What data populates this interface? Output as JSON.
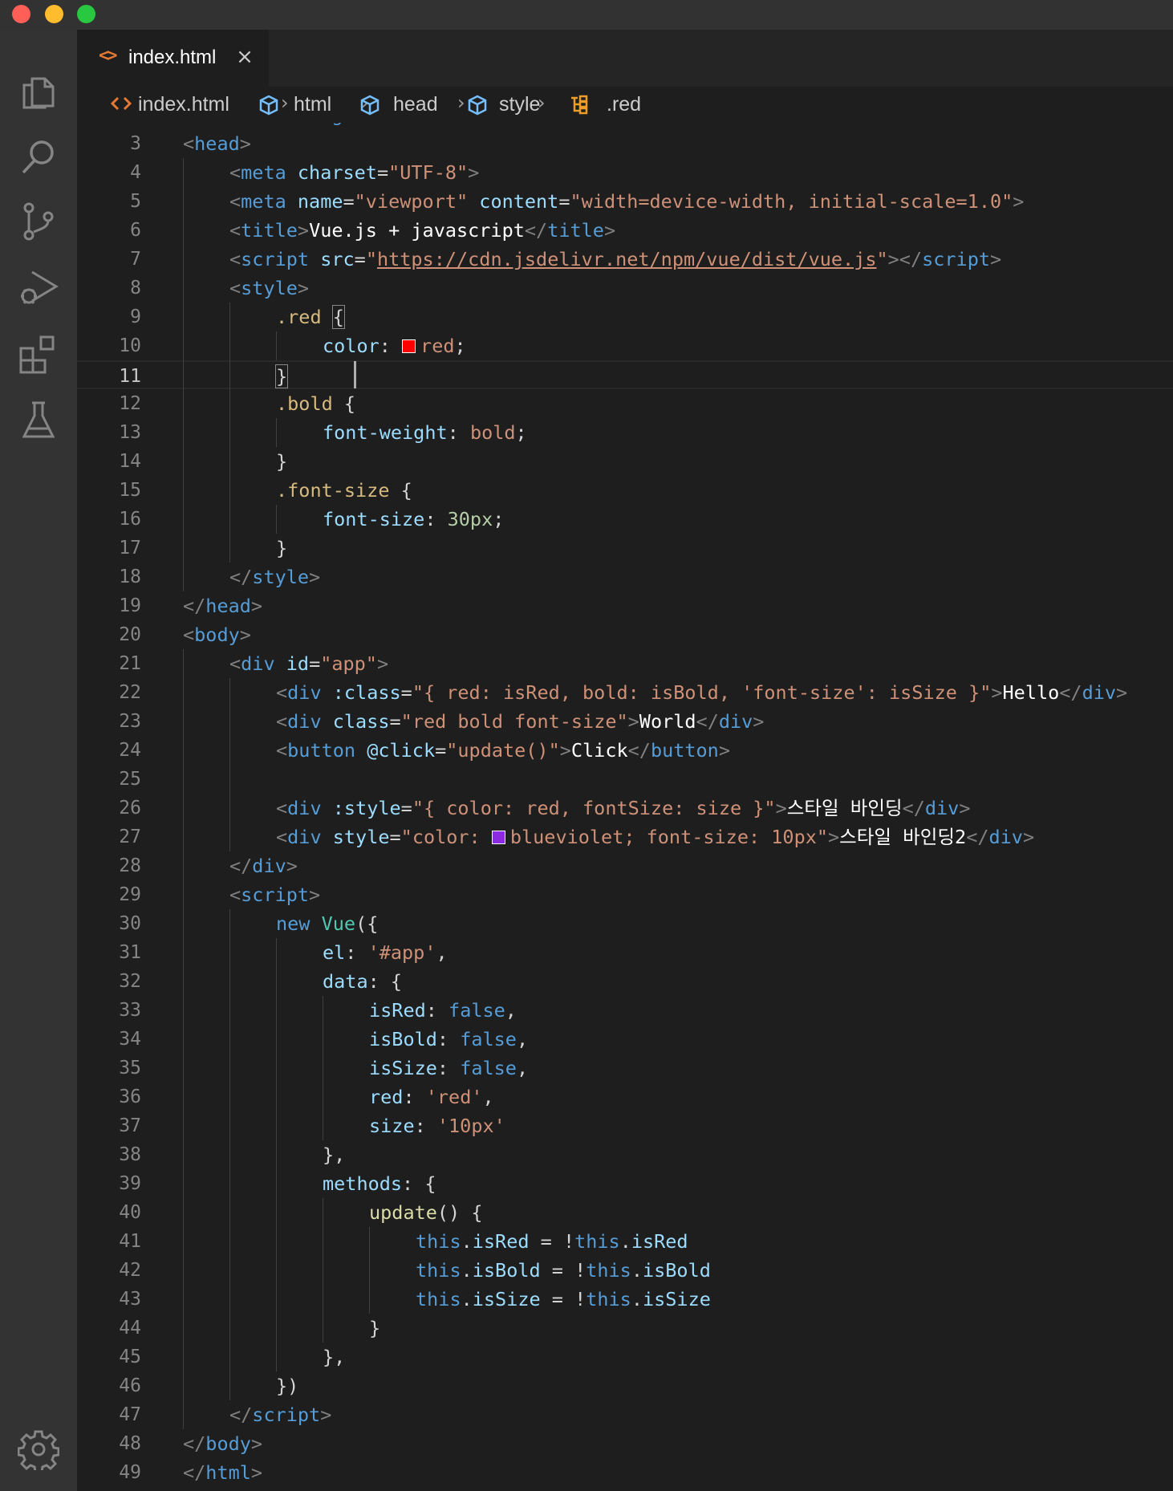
{
  "tab": {
    "label": "index.html",
    "icon": "html-file-icon",
    "close_glyph": "×"
  },
  "breadcrumb": [
    "index.html",
    "html",
    "head",
    "style",
    ".red"
  ],
  "breadcrumb_separator": "›",
  "colors": {
    "swatch_red": "#ff0000",
    "swatch_blueviolet": "#8a2be2"
  },
  "activity_bar": [
    "explorer-icon",
    "search-icon",
    "source-control-icon",
    "run-debug-icon",
    "extensions-icon",
    "testing-icon",
    "settings-gear-icon"
  ],
  "editor": {
    "current_line": 11,
    "partial_top_line": "<html lang=\"en\">",
    "lines": [
      {
        "n": 3,
        "indent": 0,
        "tokens": [
          [
            "t-punc",
            "<"
          ],
          [
            "t-tag",
            "head"
          ],
          [
            "t-punc",
            ">"
          ]
        ]
      },
      {
        "n": 4,
        "indent": 1,
        "tokens": [
          [
            "t-punc",
            "<"
          ],
          [
            "t-tag",
            "meta"
          ],
          [
            "t-def",
            " "
          ],
          [
            "t-attr",
            "charset"
          ],
          [
            "t-def",
            "="
          ],
          [
            "t-str",
            "\"UTF-8\""
          ],
          [
            "t-punc",
            ">"
          ]
        ]
      },
      {
        "n": 5,
        "indent": 1,
        "tokens": [
          [
            "t-punc",
            "<"
          ],
          [
            "t-tag",
            "meta"
          ],
          [
            "t-def",
            " "
          ],
          [
            "t-attr",
            "name"
          ],
          [
            "t-def",
            "="
          ],
          [
            "t-str",
            "\"viewport\""
          ],
          [
            "t-def",
            " "
          ],
          [
            "t-attr",
            "content"
          ],
          [
            "t-def",
            "="
          ],
          [
            "t-str",
            "\"width=device-width, initial-scale=1.0\""
          ],
          [
            "t-punc",
            ">"
          ]
        ]
      },
      {
        "n": 6,
        "indent": 1,
        "tokens": [
          [
            "t-punc",
            "<"
          ],
          [
            "t-tag",
            "title"
          ],
          [
            "t-punc",
            ">"
          ],
          [
            "t-text",
            "Vue.js + javascript"
          ],
          [
            "t-punc",
            "</"
          ],
          [
            "t-tag",
            "title"
          ],
          [
            "t-punc",
            ">"
          ]
        ]
      },
      {
        "n": 7,
        "indent": 1,
        "tokens": [
          [
            "t-punc",
            "<"
          ],
          [
            "t-tag",
            "script"
          ],
          [
            "t-def",
            " "
          ],
          [
            "t-attr",
            "src"
          ],
          [
            "t-def",
            "="
          ],
          [
            "t-str",
            "\""
          ],
          [
            "t-str t-link",
            "https://cdn.jsdelivr.net/npm/vue/dist/vue.js"
          ],
          [
            "t-str",
            "\""
          ],
          [
            "t-punc",
            "></"
          ],
          [
            "t-tag",
            "script"
          ],
          [
            "t-punc",
            ">"
          ]
        ]
      },
      {
        "n": 8,
        "indent": 1,
        "tokens": [
          [
            "t-punc",
            "<"
          ],
          [
            "t-tag",
            "style"
          ],
          [
            "t-punc",
            ">"
          ]
        ]
      },
      {
        "n": 9,
        "indent": 2,
        "tokens": [
          [
            "t-sel",
            ".red"
          ],
          [
            "t-def",
            " "
          ],
          [
            "t-def t-bracket",
            "{"
          ]
        ]
      },
      {
        "n": 10,
        "indent": 3,
        "tokens": [
          [
            "t-prop",
            "color"
          ],
          [
            "t-def",
            ": "
          ],
          [
            "swatch",
            "swatch_red"
          ],
          [
            "t-str",
            "red"
          ],
          [
            "t-def",
            ";"
          ]
        ]
      },
      {
        "n": 11,
        "indent": 2,
        "tokens": [
          [
            "t-def t-bracket",
            "}"
          ]
        ]
      },
      {
        "n": 12,
        "indent": 2,
        "tokens": [
          [
            "t-sel",
            ".bold"
          ],
          [
            "t-def",
            " {"
          ]
        ]
      },
      {
        "n": 13,
        "indent": 3,
        "tokens": [
          [
            "t-prop",
            "font-weight"
          ],
          [
            "t-def",
            ": "
          ],
          [
            "t-str",
            "bold"
          ],
          [
            "t-def",
            ";"
          ]
        ]
      },
      {
        "n": 14,
        "indent": 2,
        "tokens": [
          [
            "t-def",
            "}"
          ]
        ]
      },
      {
        "n": 15,
        "indent": 2,
        "tokens": [
          [
            "t-sel",
            ".font-size"
          ],
          [
            "t-def",
            " {"
          ]
        ]
      },
      {
        "n": 16,
        "indent": 3,
        "tokens": [
          [
            "t-prop",
            "font-size"
          ],
          [
            "t-def",
            ": "
          ],
          [
            "t-num",
            "30px"
          ],
          [
            "t-def",
            ";"
          ]
        ]
      },
      {
        "n": 17,
        "indent": 2,
        "tokens": [
          [
            "t-def",
            "}"
          ]
        ]
      },
      {
        "n": 18,
        "indent": 1,
        "tokens": [
          [
            "t-punc",
            "</"
          ],
          [
            "t-tag",
            "style"
          ],
          [
            "t-punc",
            ">"
          ]
        ]
      },
      {
        "n": 19,
        "indent": 0,
        "tokens": [
          [
            "t-punc",
            "</"
          ],
          [
            "t-tag",
            "head"
          ],
          [
            "t-punc",
            ">"
          ]
        ]
      },
      {
        "n": 20,
        "indent": 0,
        "tokens": [
          [
            "t-punc",
            "<"
          ],
          [
            "t-tag",
            "body"
          ],
          [
            "t-punc",
            ">"
          ]
        ]
      },
      {
        "n": 21,
        "indent": 1,
        "tokens": [
          [
            "t-punc",
            "<"
          ],
          [
            "t-tag",
            "div"
          ],
          [
            "t-def",
            " "
          ],
          [
            "t-attr",
            "id"
          ],
          [
            "t-def",
            "="
          ],
          [
            "t-str",
            "\"app\""
          ],
          [
            "t-punc",
            ">"
          ]
        ]
      },
      {
        "n": 22,
        "indent": 2,
        "tokens": [
          [
            "t-punc",
            "<"
          ],
          [
            "t-tag",
            "div"
          ],
          [
            "t-def",
            " "
          ],
          [
            "t-attr",
            ":class"
          ],
          [
            "t-def",
            "="
          ],
          [
            "t-str",
            "\"{ red: isRed, bold: isBold, 'font-size': isSize }\""
          ],
          [
            "t-punc",
            ">"
          ],
          [
            "t-text",
            "Hello"
          ],
          [
            "t-punc",
            "</"
          ],
          [
            "t-tag",
            "div"
          ],
          [
            "t-punc",
            ">"
          ]
        ]
      },
      {
        "n": 23,
        "indent": 2,
        "tokens": [
          [
            "t-punc",
            "<"
          ],
          [
            "t-tag",
            "div"
          ],
          [
            "t-def",
            " "
          ],
          [
            "t-attr",
            "class"
          ],
          [
            "t-def",
            "="
          ],
          [
            "t-str",
            "\"red bold font-size\""
          ],
          [
            "t-punc",
            ">"
          ],
          [
            "t-text",
            "World"
          ],
          [
            "t-punc",
            "</"
          ],
          [
            "t-tag",
            "div"
          ],
          [
            "t-punc",
            ">"
          ]
        ]
      },
      {
        "n": 24,
        "indent": 2,
        "tokens": [
          [
            "t-punc",
            "<"
          ],
          [
            "t-tag",
            "button"
          ],
          [
            "t-def",
            " "
          ],
          [
            "t-attr",
            "@click"
          ],
          [
            "t-def",
            "="
          ],
          [
            "t-str",
            "\"update()\""
          ],
          [
            "t-punc",
            ">"
          ],
          [
            "t-text",
            "Click"
          ],
          [
            "t-punc",
            "</"
          ],
          [
            "t-tag",
            "button"
          ],
          [
            "t-punc",
            ">"
          ]
        ]
      },
      {
        "n": 25,
        "indent": 2,
        "tokens": []
      },
      {
        "n": 26,
        "indent": 2,
        "tokens": [
          [
            "t-punc",
            "<"
          ],
          [
            "t-tag",
            "div"
          ],
          [
            "t-def",
            " "
          ],
          [
            "t-attr",
            ":style"
          ],
          [
            "t-def",
            "="
          ],
          [
            "t-str",
            "\"{ color: red, fontSize: size }\""
          ],
          [
            "t-punc",
            ">"
          ],
          [
            "t-text",
            "스타일 바인딩"
          ],
          [
            "t-punc",
            "</"
          ],
          [
            "t-tag",
            "div"
          ],
          [
            "t-punc",
            ">"
          ]
        ]
      },
      {
        "n": 27,
        "indent": 2,
        "tokens": [
          [
            "t-punc",
            "<"
          ],
          [
            "t-tag",
            "div"
          ],
          [
            "t-def",
            " "
          ],
          [
            "t-attr",
            "style"
          ],
          [
            "t-def",
            "="
          ],
          [
            "t-str",
            "\"color: "
          ],
          [
            "swatch",
            "swatch_blueviolet"
          ],
          [
            "t-str",
            "blueviolet; font-size: 10px\""
          ],
          [
            "t-punc",
            ">"
          ],
          [
            "t-text",
            "스타일 바인딩2"
          ],
          [
            "t-punc",
            "</"
          ],
          [
            "t-tag",
            "div"
          ],
          [
            "t-punc",
            ">"
          ]
        ]
      },
      {
        "n": 28,
        "indent": 1,
        "tokens": [
          [
            "t-punc",
            "</"
          ],
          [
            "t-tag",
            "div"
          ],
          [
            "t-punc",
            ">"
          ]
        ]
      },
      {
        "n": 29,
        "indent": 1,
        "tokens": [
          [
            "t-punc",
            "<"
          ],
          [
            "t-tag",
            "script"
          ],
          [
            "t-punc",
            ">"
          ]
        ]
      },
      {
        "n": 30,
        "indent": 2,
        "tokens": [
          [
            "t-kw",
            "new"
          ],
          [
            "t-def",
            " "
          ],
          [
            "t-cls",
            "Vue"
          ],
          [
            "t-def",
            "({"
          ]
        ]
      },
      {
        "n": 31,
        "indent": 3,
        "tokens": [
          [
            "t-prop",
            "el"
          ],
          [
            "t-def",
            ": "
          ],
          [
            "t-str",
            "'#app'"
          ],
          [
            "t-def",
            ","
          ]
        ]
      },
      {
        "n": 32,
        "indent": 3,
        "tokens": [
          [
            "t-prop",
            "data"
          ],
          [
            "t-def",
            ": {"
          ]
        ]
      },
      {
        "n": 33,
        "indent": 4,
        "tokens": [
          [
            "t-prop",
            "isRed"
          ],
          [
            "t-def",
            ": "
          ],
          [
            "t-kw",
            "false"
          ],
          [
            "t-def",
            ","
          ]
        ]
      },
      {
        "n": 34,
        "indent": 4,
        "tokens": [
          [
            "t-prop",
            "isBold"
          ],
          [
            "t-def",
            ": "
          ],
          [
            "t-kw",
            "false"
          ],
          [
            "t-def",
            ","
          ]
        ]
      },
      {
        "n": 35,
        "indent": 4,
        "tokens": [
          [
            "t-prop",
            "isSize"
          ],
          [
            "t-def",
            ": "
          ],
          [
            "t-kw",
            "false"
          ],
          [
            "t-def",
            ","
          ]
        ]
      },
      {
        "n": 36,
        "indent": 4,
        "tokens": [
          [
            "t-prop",
            "red"
          ],
          [
            "t-def",
            ": "
          ],
          [
            "t-str",
            "'red'"
          ],
          [
            "t-def",
            ","
          ]
        ]
      },
      {
        "n": 37,
        "indent": 4,
        "tokens": [
          [
            "t-prop",
            "size"
          ],
          [
            "t-def",
            ": "
          ],
          [
            "t-str",
            "'10px'"
          ]
        ]
      },
      {
        "n": 38,
        "indent": 3,
        "tokens": [
          [
            "t-def",
            "},"
          ]
        ]
      },
      {
        "n": 39,
        "indent": 3,
        "tokens": [
          [
            "t-prop",
            "methods"
          ],
          [
            "t-def",
            ": {"
          ]
        ]
      },
      {
        "n": 40,
        "indent": 4,
        "tokens": [
          [
            "t-fn",
            "update"
          ],
          [
            "t-def",
            "() {"
          ]
        ]
      },
      {
        "n": 41,
        "indent": 5,
        "tokens": [
          [
            "t-kw",
            "this"
          ],
          [
            "t-def",
            "."
          ],
          [
            "t-prop",
            "isRed"
          ],
          [
            "t-def",
            " = !"
          ],
          [
            "t-kw",
            "this"
          ],
          [
            "t-def",
            "."
          ],
          [
            "t-prop",
            "isRed"
          ]
        ]
      },
      {
        "n": 42,
        "indent": 5,
        "tokens": [
          [
            "t-kw",
            "this"
          ],
          [
            "t-def",
            "."
          ],
          [
            "t-prop",
            "isBold"
          ],
          [
            "t-def",
            " = !"
          ],
          [
            "t-kw",
            "this"
          ],
          [
            "t-def",
            "."
          ],
          [
            "t-prop",
            "isBold"
          ]
        ]
      },
      {
        "n": 43,
        "indent": 5,
        "tokens": [
          [
            "t-kw",
            "this"
          ],
          [
            "t-def",
            "."
          ],
          [
            "t-prop",
            "isSize"
          ],
          [
            "t-def",
            " = !"
          ],
          [
            "t-kw",
            "this"
          ],
          [
            "t-def",
            "."
          ],
          [
            "t-prop",
            "isSize"
          ]
        ]
      },
      {
        "n": 44,
        "indent": 4,
        "tokens": [
          [
            "t-def",
            "}"
          ]
        ]
      },
      {
        "n": 45,
        "indent": 3,
        "tokens": [
          [
            "t-def",
            "},"
          ]
        ]
      },
      {
        "n": 46,
        "indent": 2,
        "tokens": [
          [
            "t-def",
            "})"
          ]
        ]
      },
      {
        "n": 47,
        "indent": 1,
        "tokens": [
          [
            "t-punc",
            "</"
          ],
          [
            "t-tag",
            "script"
          ],
          [
            "t-punc",
            ">"
          ]
        ]
      },
      {
        "n": 48,
        "indent": 0,
        "tokens": [
          [
            "t-punc",
            "</"
          ],
          [
            "t-tag",
            "body"
          ],
          [
            "t-punc",
            ">"
          ]
        ]
      },
      {
        "n": 49,
        "indent": 0,
        "tokens": [
          [
            "t-punc",
            "</"
          ],
          [
            "t-tag",
            "html"
          ],
          [
            "t-punc",
            ">"
          ]
        ]
      }
    ]
  }
}
